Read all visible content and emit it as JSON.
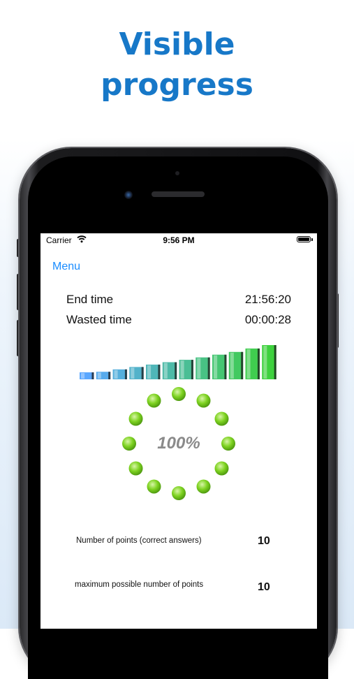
{
  "headline": {
    "line1": "Visible",
    "line2": "progress"
  },
  "status_bar": {
    "carrier": "Carrier",
    "time": "9:56 PM",
    "wifi_icon": "wifi-icon",
    "battery_icon": "battery-icon"
  },
  "nav": {
    "menu_label": "Menu"
  },
  "times": {
    "end_label": "End time",
    "end_value": "21:56:20",
    "wasted_label": "Wasted time",
    "wasted_value": "00:00:28"
  },
  "progress": {
    "bar_count": 12,
    "bar_levels": [
      0.15,
      0.22,
      0.29,
      0.36,
      0.43,
      0.5,
      0.57,
      0.64,
      0.72,
      0.8,
      0.9,
      1.0
    ],
    "colors": {
      "start": "#5aa7ff",
      "end": "#3dd13d"
    },
    "percent_text": "100%",
    "percent_value": 100,
    "dot_count": 12,
    "dot_color": "#7ed321"
  },
  "stats": {
    "points_label": "Number of points (correct answers)",
    "points_value": "10",
    "max_label": "maximum possible number of points",
    "max_value": "10"
  },
  "colors": {
    "accent": "#1778c8",
    "link": "#1a8cff"
  }
}
